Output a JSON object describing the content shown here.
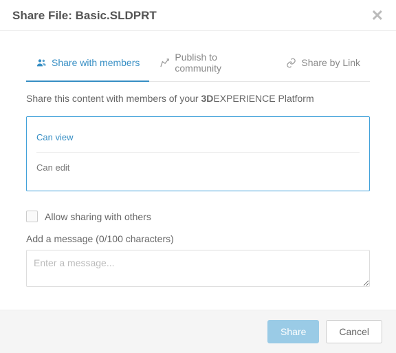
{
  "header": {
    "title": "Share File: Basic.SLDPRT"
  },
  "tabs": [
    {
      "label": "Share with members",
      "active": true
    },
    {
      "label": "Publish to community",
      "active": false
    },
    {
      "label": "Share by Link",
      "active": false
    }
  ],
  "subtitle": {
    "prefix": "Share this content with members of your ",
    "brand_bold": "3D",
    "brand_rest": "EXPERIENCE Platform"
  },
  "permissions": {
    "view_label": "Can view",
    "edit_label": "Can edit"
  },
  "allow_sharing": {
    "checked": false,
    "label": "Allow sharing with others"
  },
  "message": {
    "label": "Add a message (0/100 characters)",
    "placeholder": "Enter a message...",
    "value": ""
  },
  "buttons": {
    "share": "Share",
    "cancel": "Cancel"
  }
}
